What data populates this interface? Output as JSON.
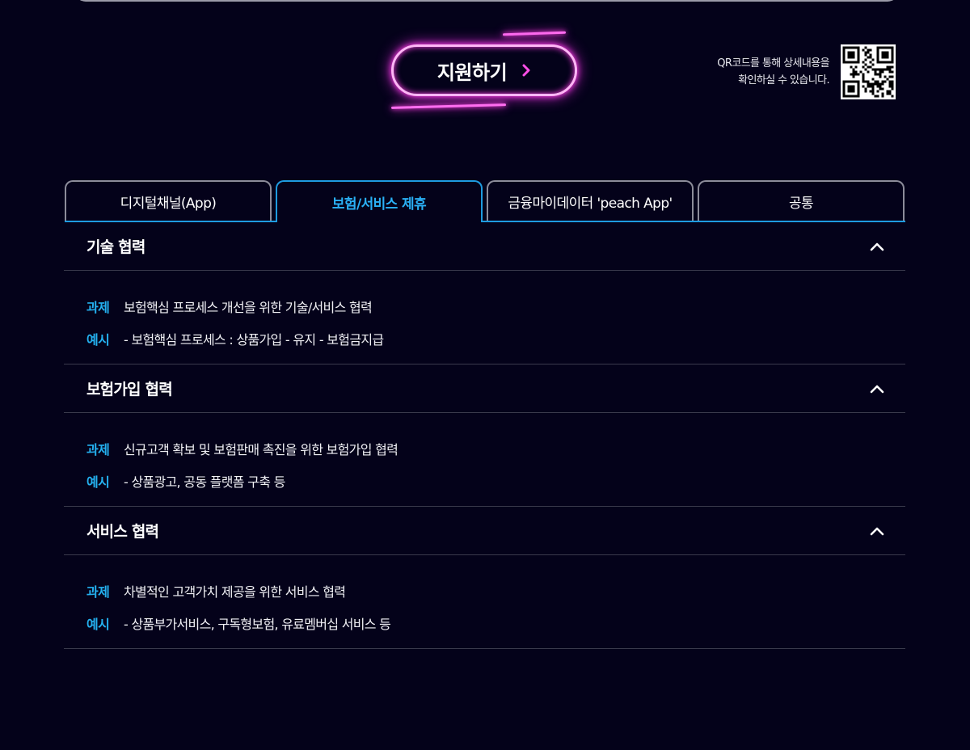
{
  "apply_button": {
    "label": "지원하기"
  },
  "qr": {
    "text_line1": "QR코드를 통해 상세내용을",
    "text_line2": "확인하실 수 있습니다."
  },
  "tabs": [
    {
      "label": "디지털채널(App)",
      "active": false
    },
    {
      "label": "보험/서비스 제휴",
      "active": true
    },
    {
      "label": "금융마이데이터 'peach App'",
      "active": false
    },
    {
      "label": "공통",
      "active": false
    }
  ],
  "sections": [
    {
      "title": "기술 협력",
      "task_label": "과제",
      "task": "보험핵심 프로세스 개선을 위한 기술/서비스 협력",
      "example_label": "예시",
      "example": "- 보험핵심 프로세스 : 상품가입 - 유지 - 보험금지급"
    },
    {
      "title": "보험가입 협력",
      "task_label": "과제",
      "task": "신규고객 확보 및 보험판매 촉진을 위한 보험가입 협력",
      "example_label": "예시",
      "example": "- 상품광고, 공동 플랫폼 구축 등"
    },
    {
      "title": "서비스 협력",
      "task_label": "과제",
      "task": "차별적인 고객가치 제공을 위한 서비스 협력",
      "example_label": "예시",
      "example": "- 상품부가서비스, 구독형보험, 유료멤버십 서비스 등"
    }
  ],
  "colors": {
    "background": "#04021a",
    "accent_blue": "#24b1f0",
    "neon_pink": "#ff3ce6"
  }
}
